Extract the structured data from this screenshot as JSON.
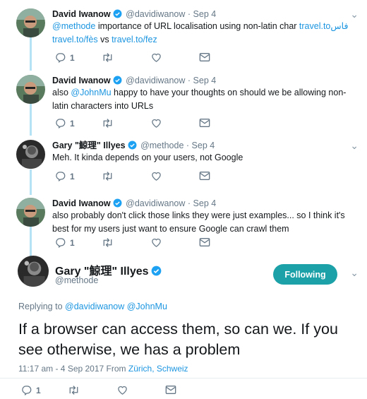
{
  "tweets": [
    {
      "name": "David Iwanow",
      "handle": "@davidiwanow",
      "date": "· Sep 4",
      "mention": "@methode",
      "text1": " importance of URL localisation using non-latin char ",
      "link1": "travel.toفاس",
      "link2": "travel.to/fès",
      "text2": " vs ",
      "link3": "travel.to/fez",
      "replies": "1"
    },
    {
      "name": "David Iwanow",
      "handle": "@davidiwanow",
      "date": "· Sep 4",
      "text_pre": "also ",
      "mention": "@JohnMu",
      "text1": " happy to have your thoughts on should we be allowing non-",
      "line2": "latin characters into URLs",
      "replies": "1"
    },
    {
      "name": "Gary \"鯨理\" Illyes",
      "handle": "@methode",
      "date": "· Sep 4",
      "line1": "Meh. It kinda depends on your users, not Google",
      "replies": "1"
    },
    {
      "name": "David Iwanow",
      "handle": "@davidiwanow",
      "date": "· Sep 4",
      "line1": "also probably don't click those links they were just examples... so I think it's",
      "line2": "best for my users just want to ensure Google can crawl them",
      "replies": "1"
    }
  ],
  "main": {
    "name": "Gary \"鯨理\" Illyes",
    "handle": "@methode",
    "follow_label": "Following",
    "replying_prefix": "Replying to ",
    "replying_to": "@davidiwanow @JohnMu",
    "text": "If a browser can access them, so can we. If you see otherwise, we has a problem",
    "timestamp": "11:17 am - 4 Sep 2017 From ",
    "location": "Zürich, Schweiz",
    "replies": "1"
  },
  "colors": {
    "accent": "#1da1a8",
    "link": "#1b95e0",
    "thread": "#b6e2f5",
    "muted": "#657786"
  }
}
